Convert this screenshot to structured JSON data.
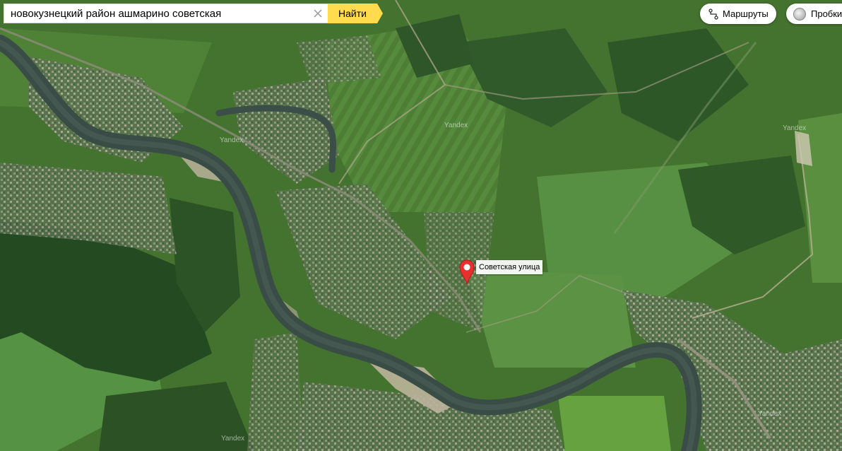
{
  "search": {
    "value": "новокузнецкий район ашмарино советская",
    "find_label": "Найти"
  },
  "controls": {
    "routes_label": "Маршруты",
    "traffic_label": "Пробки"
  },
  "placemark": {
    "label": "Советская улица"
  },
  "watermarks": [
    "Yandex",
    "Yandex",
    "Yandex",
    "Yandex",
    "Yandex"
  ],
  "colors": {
    "find_button": "#ffdb4d",
    "placemark": "#e8312f",
    "river": "#3c4f4a",
    "vegetation": "#3f6a30",
    "forest": "#254d22",
    "fields": "#5a8a3e",
    "settlement": "#6d7d5c"
  }
}
